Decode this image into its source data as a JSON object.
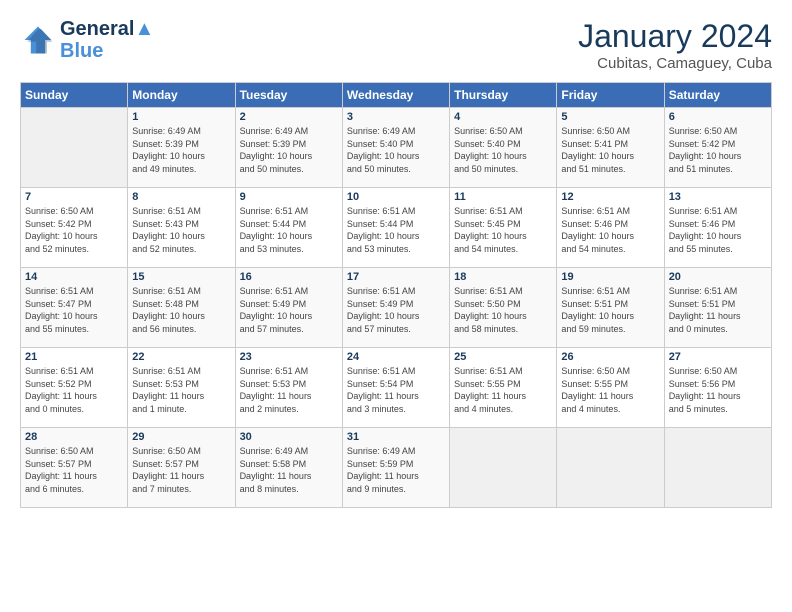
{
  "header": {
    "logo_line1": "General",
    "logo_line2": "Blue",
    "title": "January 2024",
    "subtitle": "Cubitas, Camaguey, Cuba"
  },
  "columns": [
    "Sunday",
    "Monday",
    "Tuesday",
    "Wednesday",
    "Thursday",
    "Friday",
    "Saturday"
  ],
  "weeks": [
    [
      {
        "day": "",
        "info": ""
      },
      {
        "day": "1",
        "info": "Sunrise: 6:49 AM\nSunset: 5:39 PM\nDaylight: 10 hours\nand 49 minutes."
      },
      {
        "day": "2",
        "info": "Sunrise: 6:49 AM\nSunset: 5:39 PM\nDaylight: 10 hours\nand 50 minutes."
      },
      {
        "day": "3",
        "info": "Sunrise: 6:49 AM\nSunset: 5:40 PM\nDaylight: 10 hours\nand 50 minutes."
      },
      {
        "day": "4",
        "info": "Sunrise: 6:50 AM\nSunset: 5:40 PM\nDaylight: 10 hours\nand 50 minutes."
      },
      {
        "day": "5",
        "info": "Sunrise: 6:50 AM\nSunset: 5:41 PM\nDaylight: 10 hours\nand 51 minutes."
      },
      {
        "day": "6",
        "info": "Sunrise: 6:50 AM\nSunset: 5:42 PM\nDaylight: 10 hours\nand 51 minutes."
      }
    ],
    [
      {
        "day": "7",
        "info": "Sunrise: 6:50 AM\nSunset: 5:42 PM\nDaylight: 10 hours\nand 52 minutes."
      },
      {
        "day": "8",
        "info": "Sunrise: 6:51 AM\nSunset: 5:43 PM\nDaylight: 10 hours\nand 52 minutes."
      },
      {
        "day": "9",
        "info": "Sunrise: 6:51 AM\nSunset: 5:44 PM\nDaylight: 10 hours\nand 53 minutes."
      },
      {
        "day": "10",
        "info": "Sunrise: 6:51 AM\nSunset: 5:44 PM\nDaylight: 10 hours\nand 53 minutes."
      },
      {
        "day": "11",
        "info": "Sunrise: 6:51 AM\nSunset: 5:45 PM\nDaylight: 10 hours\nand 54 minutes."
      },
      {
        "day": "12",
        "info": "Sunrise: 6:51 AM\nSunset: 5:46 PM\nDaylight: 10 hours\nand 54 minutes."
      },
      {
        "day": "13",
        "info": "Sunrise: 6:51 AM\nSunset: 5:46 PM\nDaylight: 10 hours\nand 55 minutes."
      }
    ],
    [
      {
        "day": "14",
        "info": "Sunrise: 6:51 AM\nSunset: 5:47 PM\nDaylight: 10 hours\nand 55 minutes."
      },
      {
        "day": "15",
        "info": "Sunrise: 6:51 AM\nSunset: 5:48 PM\nDaylight: 10 hours\nand 56 minutes."
      },
      {
        "day": "16",
        "info": "Sunrise: 6:51 AM\nSunset: 5:49 PM\nDaylight: 10 hours\nand 57 minutes."
      },
      {
        "day": "17",
        "info": "Sunrise: 6:51 AM\nSunset: 5:49 PM\nDaylight: 10 hours\nand 57 minutes."
      },
      {
        "day": "18",
        "info": "Sunrise: 6:51 AM\nSunset: 5:50 PM\nDaylight: 10 hours\nand 58 minutes."
      },
      {
        "day": "19",
        "info": "Sunrise: 6:51 AM\nSunset: 5:51 PM\nDaylight: 10 hours\nand 59 minutes."
      },
      {
        "day": "20",
        "info": "Sunrise: 6:51 AM\nSunset: 5:51 PM\nDaylight: 11 hours\nand 0 minutes."
      }
    ],
    [
      {
        "day": "21",
        "info": "Sunrise: 6:51 AM\nSunset: 5:52 PM\nDaylight: 11 hours\nand 0 minutes."
      },
      {
        "day": "22",
        "info": "Sunrise: 6:51 AM\nSunset: 5:53 PM\nDaylight: 11 hours\nand 1 minute."
      },
      {
        "day": "23",
        "info": "Sunrise: 6:51 AM\nSunset: 5:53 PM\nDaylight: 11 hours\nand 2 minutes."
      },
      {
        "day": "24",
        "info": "Sunrise: 6:51 AM\nSunset: 5:54 PM\nDaylight: 11 hours\nand 3 minutes."
      },
      {
        "day": "25",
        "info": "Sunrise: 6:51 AM\nSunset: 5:55 PM\nDaylight: 11 hours\nand 4 minutes."
      },
      {
        "day": "26",
        "info": "Sunrise: 6:50 AM\nSunset: 5:55 PM\nDaylight: 11 hours\nand 4 minutes."
      },
      {
        "day": "27",
        "info": "Sunrise: 6:50 AM\nSunset: 5:56 PM\nDaylight: 11 hours\nand 5 minutes."
      }
    ],
    [
      {
        "day": "28",
        "info": "Sunrise: 6:50 AM\nSunset: 5:57 PM\nDaylight: 11 hours\nand 6 minutes."
      },
      {
        "day": "29",
        "info": "Sunrise: 6:50 AM\nSunset: 5:57 PM\nDaylight: 11 hours\nand 7 minutes."
      },
      {
        "day": "30",
        "info": "Sunrise: 6:49 AM\nSunset: 5:58 PM\nDaylight: 11 hours\nand 8 minutes."
      },
      {
        "day": "31",
        "info": "Sunrise: 6:49 AM\nSunset: 5:59 PM\nDaylight: 11 hours\nand 9 minutes."
      },
      {
        "day": "",
        "info": ""
      },
      {
        "day": "",
        "info": ""
      },
      {
        "day": "",
        "info": ""
      }
    ]
  ]
}
